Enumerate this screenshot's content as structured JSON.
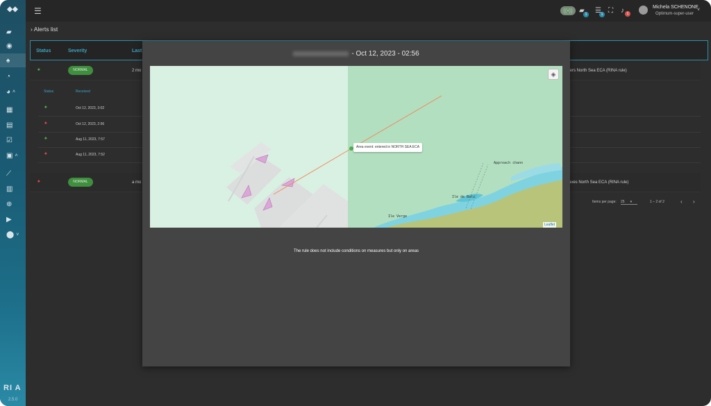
{
  "app": {
    "version": "2.5.0",
    "logo": "RI A"
  },
  "sidebar": {
    "items": [
      {
        "icon": "ship-icon"
      },
      {
        "icon": "globe-icon"
      },
      {
        "icon": "bell-icon",
        "active": true
      },
      {
        "icon": "gauge-icon"
      },
      {
        "icon": "pie-chart-icon",
        "expandable": true
      },
      {
        "icon": "dashboard-icon"
      },
      {
        "icon": "calendar-icon"
      },
      {
        "icon": "checklist-icon"
      },
      {
        "icon": "report-icon",
        "expandable": true
      },
      {
        "icon": "trend-icon"
      },
      {
        "icon": "book-icon"
      },
      {
        "icon": "target-icon"
      },
      {
        "icon": "video-icon"
      },
      {
        "icon": "pin-icon",
        "expandable": true
      }
    ]
  },
  "topbar": {
    "notifications": {
      "ships_badge": "1",
      "filters_badge": "1",
      "alerts_badge": "1"
    },
    "user": {
      "name": "Michela SCHENONE",
      "role": "Optimum-super-user"
    }
  },
  "breadcrumb": {
    "label": "Alerts list"
  },
  "table": {
    "headers": {
      "status": "Status",
      "severity": "Severity",
      "last": "Last"
    },
    "rows": [
      {
        "severity": "NORMAL",
        "last": "2 mo",
        "description": "ters North Sea ECA (RINA rule)"
      },
      {
        "severity": "NORMAL",
        "last": "a mo",
        "description": "aves North Sea ECA (RINA rule)"
      }
    ],
    "subtable": {
      "headers": {
        "status": "Status",
        "received": "Received"
      },
      "rows": [
        {
          "status": "ok",
          "received": "Oct 12, 2023, 3:02"
        },
        {
          "status": "alert",
          "received": "Oct 12, 2023, 2:56"
        },
        {
          "status": "ok",
          "received": "Aug 11, 2023, 7:57"
        },
        {
          "status": "alert",
          "received": "Aug 11, 2023, 7:52"
        }
      ]
    },
    "paginator": {
      "items_per_page_label": "Items per page:",
      "items_per_page": "25",
      "range": "1 – 2 of 2"
    }
  },
  "modal": {
    "title_date": "- Oct 12, 2023 - 02:56",
    "map": {
      "popup": "Area event: entered in NORTH SEA ECA",
      "labels": {
        "approach": "Approach chann",
        "ile_batz": "Ile de Batz",
        "ile_verge": "Ile Verge"
      },
      "attribution": "Leaflet",
      "colors": {
        "outside_area": "#d9f1e3",
        "inside_area": "#b2dfc0",
        "track": "#f08a5a",
        "land": "#b8c47a",
        "shallow": "#7fd3e0"
      }
    },
    "message": "The rule does not include conditions on measures but only on areas"
  }
}
